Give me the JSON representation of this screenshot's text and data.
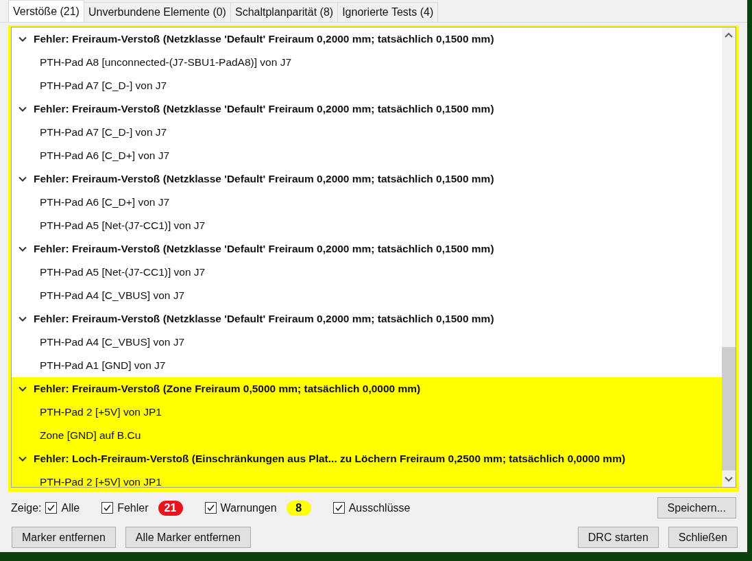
{
  "tabs": [
    {
      "label": "Verstöße (21)",
      "selected": true
    },
    {
      "label": "Unverbundene Elemente (0)",
      "selected": false
    },
    {
      "label": "Schaltplanparität (8)",
      "selected": false
    },
    {
      "label": "Ignorierte Tests (4)",
      "selected": false
    }
  ],
  "violations": [
    {
      "title": "Fehler: Freiraum-Verstoß (Netzklasse 'Default' Freiraum 0,2000 mm; tatsächlich 0,1500 mm)",
      "expanded": true,
      "highlighted": false,
      "items": [
        "PTH-Pad A8 [unconnected-(J7-SBU1-PadA8)] von J7",
        "PTH-Pad A7 [C_D-] von J7"
      ]
    },
    {
      "title": "Fehler: Freiraum-Verstoß (Netzklasse 'Default' Freiraum 0,2000 mm; tatsächlich 0,1500 mm)",
      "expanded": true,
      "highlighted": false,
      "items": [
        "PTH-Pad A7 [C_D-] von J7",
        "PTH-Pad A6 [C_D+] von J7"
      ]
    },
    {
      "title": "Fehler: Freiraum-Verstoß (Netzklasse 'Default' Freiraum 0,2000 mm; tatsächlich 0,1500 mm)",
      "expanded": true,
      "highlighted": false,
      "items": [
        "PTH-Pad A6 [C_D+] von J7",
        "PTH-Pad A5 [Net-(J7-CC1)] von J7"
      ]
    },
    {
      "title": "Fehler: Freiraum-Verstoß (Netzklasse 'Default' Freiraum 0,2000 mm; tatsächlich 0,1500 mm)",
      "expanded": true,
      "highlighted": false,
      "items": [
        "PTH-Pad A5 [Net-(J7-CC1)] von J7",
        "PTH-Pad A4 [C_VBUS] von J7"
      ]
    },
    {
      "title": "Fehler: Freiraum-Verstoß (Netzklasse 'Default' Freiraum 0,2000 mm; tatsächlich 0,1500 mm)",
      "expanded": true,
      "highlighted": false,
      "items": [
        "PTH-Pad A4 [C_VBUS] von J7",
        "PTH-Pad A1 [GND] von J7"
      ]
    },
    {
      "title": "Fehler: Freiraum-Verstoß (Zone Freiraum 0,5000 mm; tatsächlich 0,0000 mm)",
      "expanded": true,
      "highlighted": true,
      "items": [
        "PTH-Pad 2 [+5V] von JP1",
        "Zone [GND] auf B.Cu"
      ]
    },
    {
      "title": "Fehler: Loch-Freiraum-Verstoß (Einschränkungen aus Plat... zu Löchern Freiraum 0,2500 mm; tatsächlich 0,0000 mm)",
      "expanded": true,
      "highlighted": true,
      "items": [
        "PTH-Pad 2 [+5V] von JP1"
      ]
    }
  ],
  "filters": {
    "label": "Zeige:",
    "options": [
      {
        "label": "Alle",
        "checked": true
      },
      {
        "label": "Fehler",
        "checked": true,
        "badge": {
          "text": "21",
          "color": "#e8141c"
        }
      },
      {
        "label": "Warnungen",
        "checked": true,
        "badge": {
          "text": "8",
          "color": "#ffff00"
        }
      },
      {
        "label": "Ausschlüsse",
        "checked": true
      }
    ]
  },
  "save_button": "Speichern...",
  "left_buttons": [
    "Marker entfernen",
    "Alle Marker entfernen"
  ],
  "right_buttons": [
    "DRC starten",
    "Schließen"
  ]
}
